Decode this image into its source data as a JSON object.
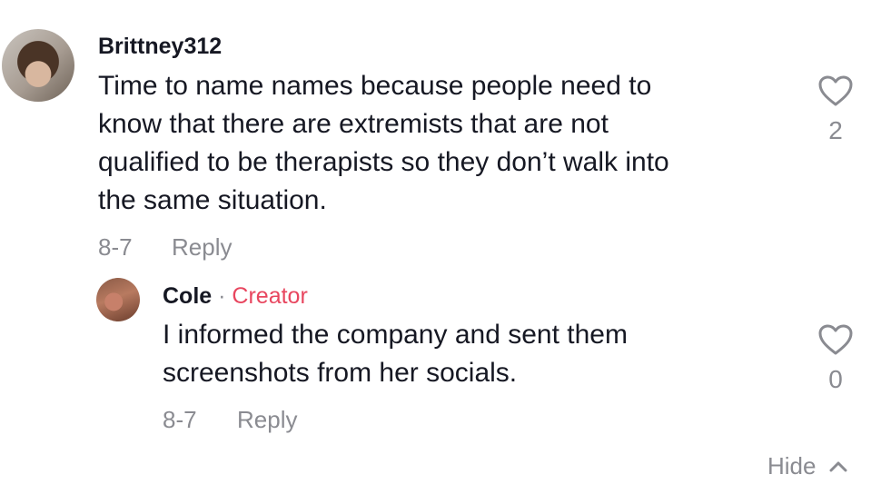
{
  "comments": [
    {
      "username": "Brittney312",
      "lines": [
        "Time to name names because people need to",
        "know that there are extremists that are not",
        "qualified to be therapists so they don’t walk into",
        "the same situation."
      ],
      "date": "8-7",
      "reply_label": "Reply",
      "likes": "2"
    }
  ],
  "reply": {
    "username": "Cole",
    "separator": "·",
    "badge": "Creator",
    "lines": [
      "I informed the company and sent them",
      "screenshots from her socials."
    ],
    "date": "8-7",
    "reply_label": "Reply",
    "likes": "0"
  },
  "hide_label": "Hide",
  "colors": {
    "creator_badge": "#e8465f",
    "muted": "#8a8b91",
    "text": "#161823"
  },
  "icons": {
    "like": "heart-outline-icon",
    "collapse": "chevron-up-icon"
  }
}
